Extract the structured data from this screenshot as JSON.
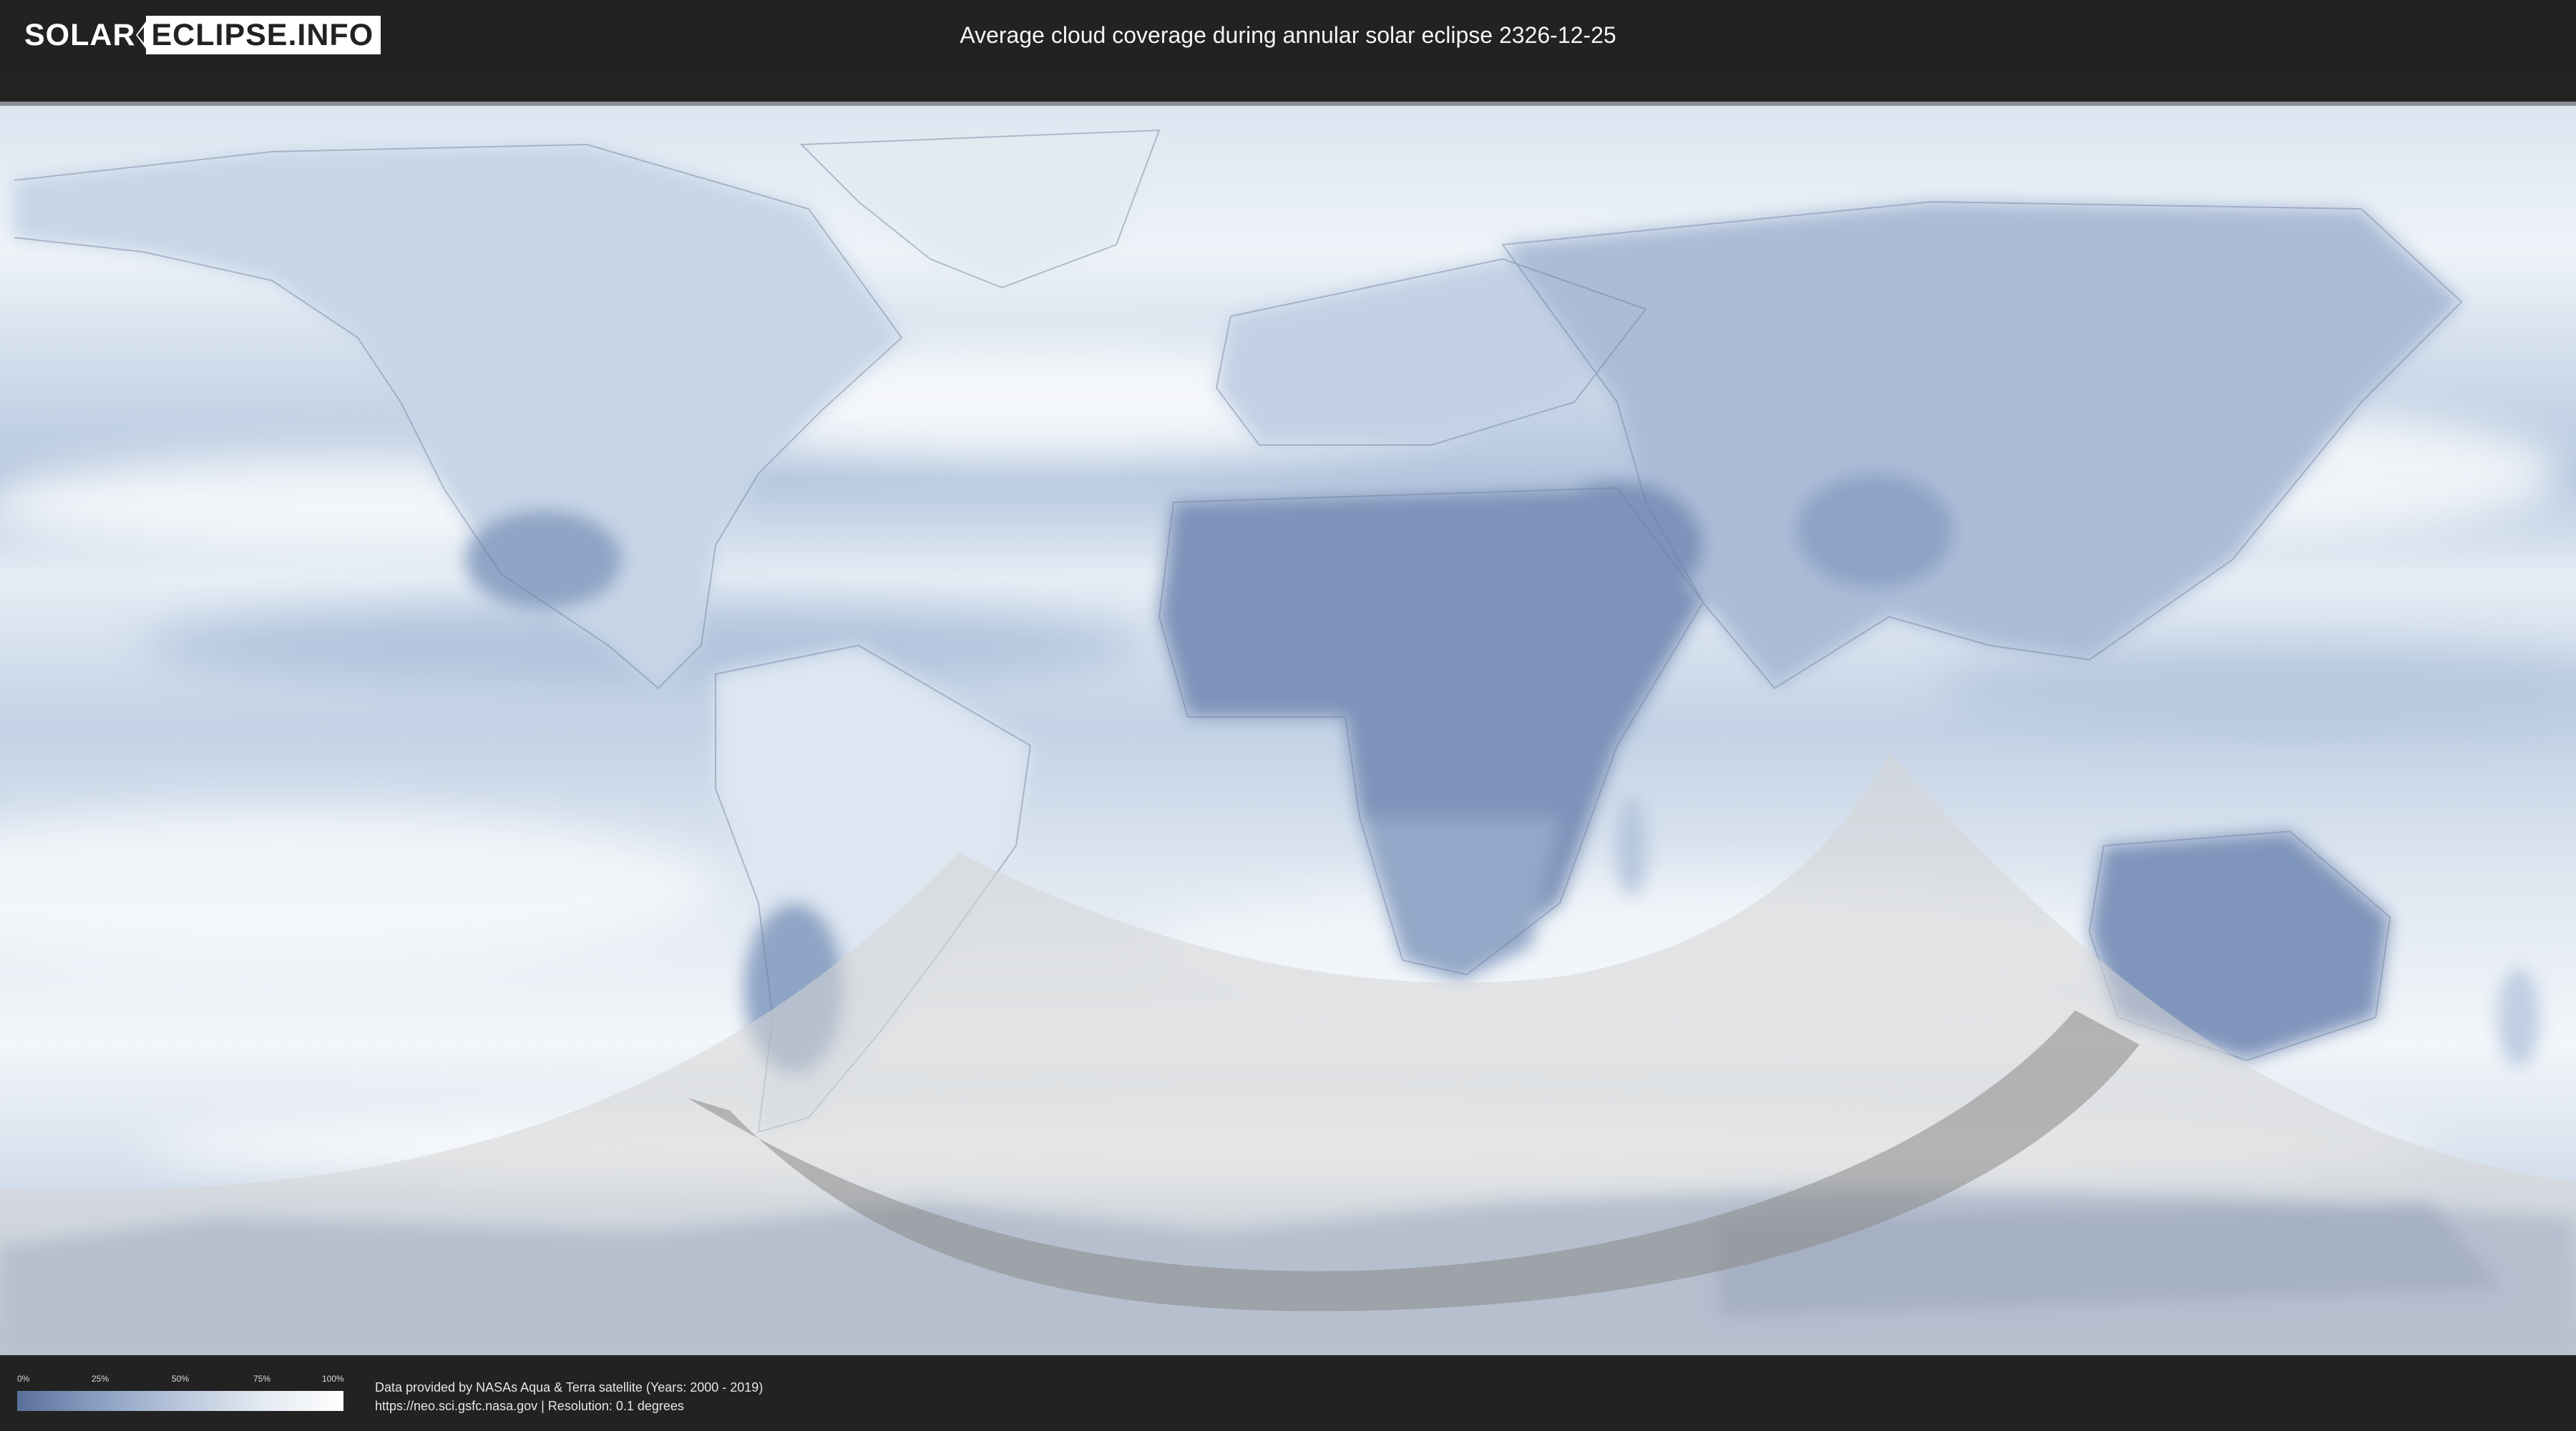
{
  "header": {
    "logo_left": "SOLAR",
    "logo_right": "ECLIPSE.INFO",
    "title": "Average cloud coverage during annular solar eclipse 2326-12-25"
  },
  "legend": {
    "ticks": [
      "0%",
      "25%",
      "50%",
      "75%",
      "100%"
    ],
    "colors": [
      "#5a6f9a",
      "#8b9fc2",
      "#b9c7dc",
      "#e3e9f1",
      "#ffffff"
    ]
  },
  "footer": {
    "credit_line1": "Data provided by NASAs Aqua & Terra satellite (Years: 2000 - 2019)",
    "credit_line2": "https://neo.sci.gsfc.nasa.gov | Resolution: 0.1 degrees"
  },
  "map": {
    "projection": "equirectangular",
    "colors": {
      "cloud_low": "#5f79a8",
      "cloud_high": "#ffffff",
      "eclipse_penumbra": "#d4d4d4",
      "annularity_path": "#8a8a8a"
    }
  }
}
